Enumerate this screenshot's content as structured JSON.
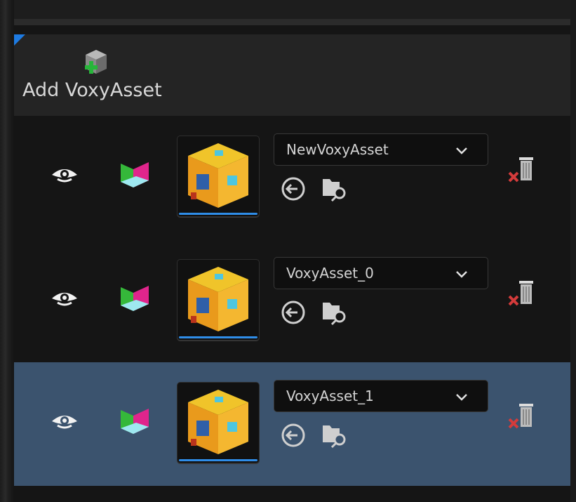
{
  "header": {
    "add_label": "Add VoxyAsset",
    "add_icon": "add-voxy-asset-icon",
    "accent_color": "#1e7be2"
  },
  "rows": [
    {
      "asset_name": "NewVoxyAsset",
      "selected": false
    },
    {
      "asset_name": "VoxyAsset_0",
      "selected": false
    },
    {
      "asset_name": "VoxyAsset_1",
      "selected": true
    }
  ],
  "icons": {
    "visibility": "eye-icon",
    "bounds": "room-icon",
    "use_selected": "use-selected-asset-icon",
    "browse": "browse-to-asset-icon",
    "remove": "remove-trash-icon",
    "dropdown": "chevron-down-icon"
  },
  "colors": {
    "row_bg": "#151515",
    "selected_row_bg": "#3b536e",
    "thumb_underline": "#2f8de8"
  }
}
